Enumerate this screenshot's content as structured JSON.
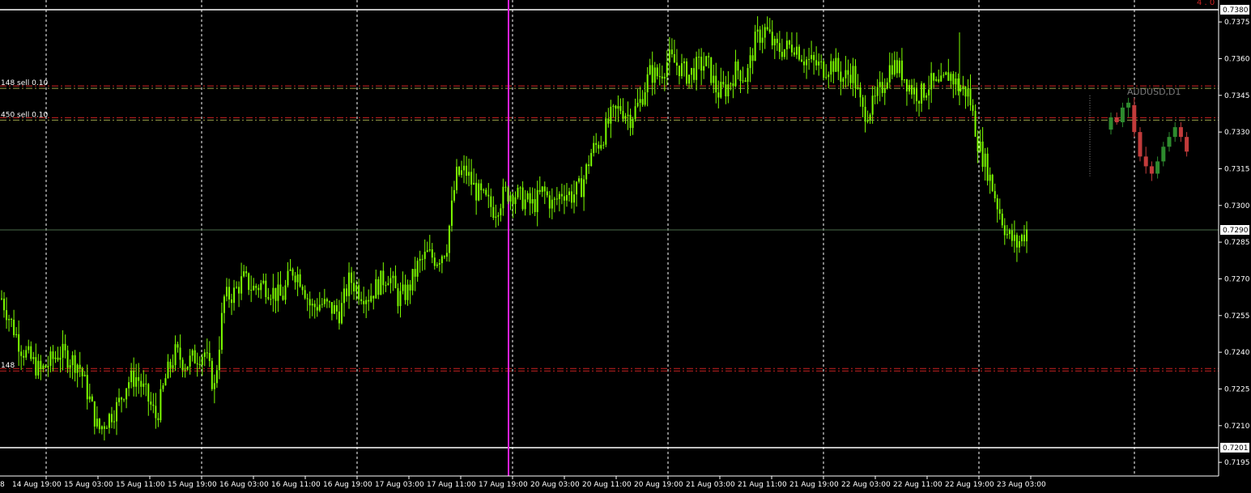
{
  "chart_data": {
    "type": "candlestick",
    "symbol_label": "AUDUSD,D1",
    "corner_text": "4 . 0",
    "colors": {
      "background": "#000000",
      "main_candles": "#7cfc00",
      "bull": "#2e8b2e",
      "bear": "#c23b3b",
      "grid": "#ffffff",
      "order_lines": "#cc2222",
      "order_lines_alt": "#9aa34a",
      "current_price_line": "#4a6b4a",
      "vertical_marker": "#e020e0",
      "bound_lines": "#ffffff"
    },
    "y_axis": {
      "range": [
        0.7189,
        0.7382
      ],
      "ticks": [
        "0.7375",
        "0.7360",
        "0.7345",
        "0.7330",
        "0.7315",
        "0.7300",
        "0.7285",
        "0.7270",
        "0.7255",
        "0.7240",
        "0.7225",
        "0.7210",
        "0.7195"
      ],
      "tick_values": [
        0.7375,
        0.736,
        0.7345,
        0.733,
        0.7315,
        0.73,
        0.7285,
        0.727,
        0.7255,
        0.724,
        0.7225,
        0.721,
        0.7195
      ],
      "highlighted": [
        {
          "label": "0.7380",
          "value": 0.738
        },
        {
          "label": "0.7290",
          "value": 0.729
        },
        {
          "label": "0.7201",
          "value": 0.7201
        }
      ]
    },
    "x_axis": {
      "first_label": "8",
      "labels": [
        "14 Aug 19:00",
        "15 Aug 03:00",
        "15 Aug 11:00",
        "15 Aug 19:00",
        "16 Aug 03:00",
        "16 Aug 11:00",
        "16 Aug 19:00",
        "17 Aug 03:00",
        "17 Aug 11:00",
        "17 Aug 19:00",
        "20 Aug 03:00",
        "20 Aug 11:00",
        "20 Aug 19:00",
        "21 Aug 03:00",
        "21 Aug 11:00",
        "21 Aug 19:00",
        "22 Aug 03:00",
        "22 Aug 11:00",
        "22 Aug 19:00",
        "23 Aug 03:00"
      ]
    },
    "levels": [
      {
        "label": "148 sell 0.10",
        "value": 0.73482
      },
      {
        "label": "450 sell 0.10",
        "value": 0.73352
      },
      {
        "label": "148",
        "value": 0.72327
      }
    ],
    "horizontal_bounds": [
      0.738,
      0.7201
    ],
    "current_price": 0.729,
    "vertical_marker_label": "17 Aug 19:00",
    "price_path": [
      [
        0,
        0.7262
      ],
      [
        2,
        0.7242
      ],
      [
        4,
        0.7232
      ],
      [
        6,
        0.724
      ],
      [
        8,
        0.7235
      ],
      [
        9,
        0.7222
      ],
      [
        10,
        0.7208
      ],
      [
        11,
        0.7213
      ],
      [
        12,
        0.7218
      ],
      [
        13,
        0.7228
      ],
      [
        14,
        0.723
      ],
      [
        15,
        0.7222
      ],
      [
        16,
        0.7213
      ],
      [
        17,
        0.723
      ],
      [
        18,
        0.724
      ],
      [
        19,
        0.7235
      ],
      [
        20,
        0.7238
      ],
      [
        21,
        0.724
      ],
      [
        22,
        0.7225
      ],
      [
        23,
        0.7262
      ],
      [
        24,
        0.7264
      ],
      [
        25,
        0.727
      ],
      [
        26,
        0.7266
      ],
      [
        27,
        0.7268
      ],
      [
        28,
        0.7265
      ],
      [
        29,
        0.7262
      ],
      [
        30,
        0.7274
      ],
      [
        31,
        0.727
      ],
      [
        32,
        0.7258
      ],
      [
        33,
        0.726
      ],
      [
        34,
        0.7258
      ],
      [
        35,
        0.7256
      ],
      [
        36,
        0.727
      ],
      [
        37,
        0.7265
      ],
      [
        38,
        0.7263
      ],
      [
        39,
        0.7268
      ],
      [
        40,
        0.7272
      ],
      [
        41,
        0.7262
      ],
      [
        42,
        0.7265
      ],
      [
        43,
        0.7275
      ],
      [
        44,
        0.728
      ],
      [
        45,
        0.7278
      ],
      [
        46,
        0.7283
      ],
      [
        47,
        0.7312
      ],
      [
        48,
        0.7314
      ],
      [
        49,
        0.7306
      ],
      [
        50,
        0.7302
      ],
      [
        51,
        0.7298
      ],
      [
        52,
        0.7305
      ],
      [
        53,
        0.7305
      ],
      [
        54,
        0.7302
      ],
      [
        55,
        0.73
      ],
      [
        56,
        0.7306
      ],
      [
        57,
        0.73
      ],
      [
        58,
        0.7306
      ],
      [
        59,
        0.7304
      ],
      [
        60,
        0.7308
      ],
      [
        61,
        0.7322
      ],
      [
        62,
        0.7327
      ],
      [
        63,
        0.7336
      ],
      [
        64,
        0.734
      ],
      [
        65,
        0.7336
      ],
      [
        66,
        0.7342
      ],
      [
        67,
        0.7354
      ],
      [
        68,
        0.7353
      ],
      [
        69,
        0.736
      ],
      [
        70,
        0.7357
      ],
      [
        71,
        0.7353
      ],
      [
        72,
        0.7357
      ],
      [
        73,
        0.7358
      ],
      [
        74,
        0.7346
      ],
      [
        75,
        0.7348
      ],
      [
        76,
        0.7356
      ],
      [
        77,
        0.7352
      ],
      [
        78,
        0.7368
      ],
      [
        79,
        0.7372
      ],
      [
        80,
        0.7364
      ],
      [
        81,
        0.7364
      ],
      [
        82,
        0.7366
      ],
      [
        83,
        0.736
      ],
      [
        84,
        0.7358
      ],
      [
        85,
        0.7356
      ],
      [
        86,
        0.7358
      ],
      [
        87,
        0.7352
      ],
      [
        88,
        0.7355
      ],
      [
        89,
        0.7338
      ],
      [
        90,
        0.734
      ],
      [
        91,
        0.7348
      ],
      [
        92,
        0.7358
      ],
      [
        93,
        0.7355
      ],
      [
        94,
        0.7348
      ],
      [
        95,
        0.7345
      ],
      [
        96,
        0.735
      ],
      [
        97,
        0.7348
      ],
      [
        98,
        0.7354
      ],
      [
        99,
        0.7348
      ],
      [
        100,
        0.7346
      ],
      [
        101,
        0.7325
      ],
      [
        102,
        0.7314
      ],
      [
        103,
        0.73
      ],
      [
        104,
        0.7288
      ],
      [
        105,
        0.7284
      ],
      [
        106,
        0.729
      ]
    ],
    "mini_candles": [
      {
        "o": 0.7331,
        "h": 0.7338,
        "l": 0.7329,
        "c": 0.7336
      },
      {
        "o": 0.7336,
        "h": 0.7338,
        "l": 0.7333,
        "c": 0.7334
      },
      {
        "o": 0.7334,
        "h": 0.7342,
        "l": 0.7332,
        "c": 0.734
      },
      {
        "o": 0.734,
        "h": 0.7344,
        "l": 0.7336,
        "c": 0.7342
      },
      {
        "o": 0.7341,
        "h": 0.7344,
        "l": 0.7328,
        "c": 0.733
      },
      {
        "o": 0.733,
        "h": 0.7332,
        "l": 0.7318,
        "c": 0.732
      },
      {
        "o": 0.732,
        "h": 0.7324,
        "l": 0.7313,
        "c": 0.7316
      },
      {
        "o": 0.7316,
        "h": 0.7318,
        "l": 0.731,
        "c": 0.7313
      },
      {
        "o": 0.7313,
        "h": 0.732,
        "l": 0.7311,
        "c": 0.7318
      },
      {
        "o": 0.7318,
        "h": 0.7326,
        "l": 0.7316,
        "c": 0.7324
      },
      {
        "o": 0.7324,
        "h": 0.733,
        "l": 0.7322,
        "c": 0.7328
      },
      {
        "o": 0.7328,
        "h": 0.7334,
        "l": 0.7326,
        "c": 0.7332
      },
      {
        "o": 0.7332,
        "h": 0.7334,
        "l": 0.7326,
        "c": 0.7328
      },
      {
        "o": 0.7328,
        "h": 0.733,
        "l": 0.732,
        "c": 0.7322
      }
    ]
  }
}
